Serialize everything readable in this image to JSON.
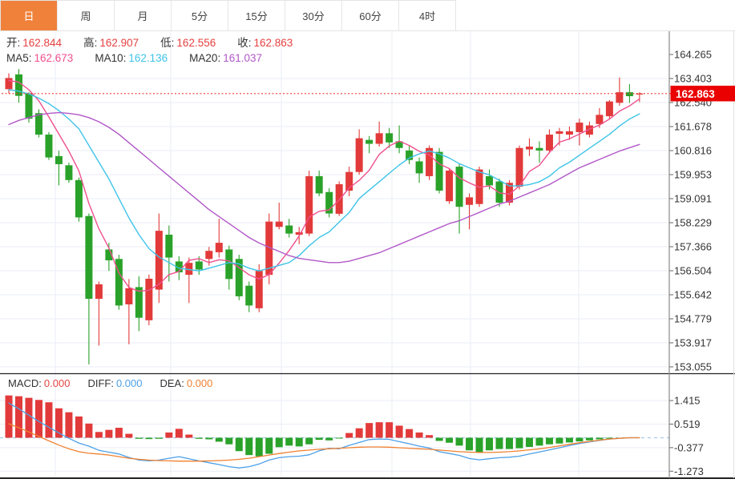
{
  "tabbar": {
    "tabs": [
      {
        "label": "日",
        "active": true
      },
      {
        "label": "周",
        "active": false
      },
      {
        "label": "月",
        "active": false
      },
      {
        "label": "5分",
        "active": false
      },
      {
        "label": "15分",
        "active": false
      },
      {
        "label": "30分",
        "active": false
      },
      {
        "label": "60分",
        "active": false
      },
      {
        "label": "4时",
        "active": false
      }
    ]
  },
  "info": {
    "ohlc": [
      {
        "label": "开:",
        "value": "162.844"
      },
      {
        "label": "高:",
        "value": "162.907"
      },
      {
        "label": "低:",
        "value": "162.556"
      },
      {
        "label": "收:",
        "value": "162.863"
      }
    ],
    "ma": [
      {
        "label": "MA5:",
        "value": "162.673"
      },
      {
        "label": "MA10:",
        "value": "162.136"
      },
      {
        "label": "MA20:",
        "value": "161.037"
      }
    ]
  },
  "macd_header": {
    "items": [
      {
        "label": "MACD:",
        "value": "0.000"
      },
      {
        "label": "DIFF:",
        "value": "0.000"
      },
      {
        "label": "DEA:",
        "value": "0.000"
      }
    ]
  },
  "colors": {
    "up": "#e23a3a",
    "down": "#2aa22a",
    "ma5": "#f0508e",
    "ma10": "#3fc3e8",
    "ma20": "#b158c8",
    "diff": "#4da0e8",
    "dea": "#f08030",
    "grid": "#e9eef6",
    "zero_dash": "#a9cbe8",
    "price_line": "#f03838",
    "price_label_bg": "#ea0000",
    "axis_line": "#888888",
    "dark_border": "#222222",
    "tab_active_bg": "#f0813a"
  },
  "chart_data": {
    "type": "candlestick+macd",
    "format": "candles are [open, high, low, close]",
    "main": {
      "y_tick_labels": [
        "164.265",
        "163.403",
        "162.540",
        "161.678",
        "160.816",
        "159.953",
        "159.091",
        "158.229",
        "157.366",
        "156.504",
        "155.642",
        "154.779",
        "153.917",
        "153.055"
      ],
      "current_price": 162.863,
      "current_price_label": "162.863",
      "candles": [
        [
          163.02,
          163.59,
          162.87,
          163.42
        ],
        [
          163.55,
          163.74,
          162.54,
          162.78
        ],
        [
          162.87,
          162.91,
          161.82,
          161.96
        ],
        [
          162.16,
          162.3,
          161.29,
          161.39
        ],
        [
          161.39,
          161.48,
          160.48,
          160.57
        ],
        [
          160.62,
          160.81,
          159.57,
          160.33
        ],
        [
          160.29,
          160.38,
          159.66,
          159.76
        ],
        [
          159.76,
          159.85,
          158.27,
          158.42
        ],
        [
          158.47,
          158.56,
          153.15,
          155.5
        ],
        [
          155.5,
          156.12,
          153.82,
          156.02
        ],
        [
          157.27,
          157.51,
          156.5,
          156.88
        ],
        [
          156.93,
          157.08,
          155.11,
          155.26
        ],
        [
          155.3,
          156.21,
          153.87,
          155.88
        ],
        [
          155.92,
          156.31,
          154.34,
          154.82
        ],
        [
          154.73,
          156.37,
          154.55,
          156.22
        ],
        [
          155.83,
          158.56,
          155.35,
          157.94
        ],
        [
          157.8,
          158.13,
          156.12,
          156.98
        ],
        [
          156.84,
          157.03,
          156.17,
          156.45
        ],
        [
          156.36,
          156.98,
          155.35,
          156.79
        ],
        [
          156.84,
          157.03,
          156.36,
          156.55
        ],
        [
          156.93,
          157.36,
          156.69,
          157.22
        ],
        [
          157.17,
          158.37,
          156.98,
          157.51
        ],
        [
          157.27,
          157.41,
          155.83,
          156.21
        ],
        [
          156.93,
          157.08,
          155.45,
          155.59
        ],
        [
          155.97,
          156.12,
          155.02,
          155.26
        ],
        [
          155.16,
          156.74,
          155.02,
          156.5
        ],
        [
          156.36,
          158.56,
          156.02,
          158.27
        ],
        [
          158.08,
          158.95,
          157.99,
          158.27
        ],
        [
          158.13,
          158.37,
          157.7,
          157.84
        ],
        [
          157.8,
          158.08,
          157.46,
          157.89
        ],
        [
          157.84,
          160.1,
          157.75,
          159.9
        ],
        [
          159.9,
          160.1,
          159.18,
          159.28
        ],
        [
          159.33,
          159.47,
          158.42,
          158.56
        ],
        [
          158.55,
          159.71,
          158.47,
          159.61
        ],
        [
          159.38,
          160.24,
          159.18,
          160.05
        ],
        [
          160.05,
          161.58,
          159.95,
          161.26
        ],
        [
          161.2,
          161.34,
          160.72,
          161.06
        ],
        [
          161.06,
          161.86,
          160.96,
          161.44
        ],
        [
          161.44,
          161.63,
          160.91,
          161.11
        ],
        [
          161.15,
          161.72,
          160.72,
          160.91
        ],
        [
          160.82,
          161.0,
          160.33,
          160.48
        ],
        [
          160.43,
          160.57,
          159.66,
          160.0
        ],
        [
          159.9,
          161.0,
          159.76,
          160.91
        ],
        [
          160.77,
          160.91,
          159.28,
          159.38
        ],
        [
          159.0,
          160.19,
          158.9,
          160.1
        ],
        [
          160.24,
          160.33,
          157.84,
          158.8
        ],
        [
          158.87,
          159.28,
          157.99,
          159.14
        ],
        [
          158.9,
          160.24,
          158.8,
          160.14
        ],
        [
          159.9,
          160.14,
          159.42,
          159.57
        ],
        [
          159.71,
          159.81,
          158.8,
          158.95
        ],
        [
          158.95,
          159.76,
          158.85,
          159.66
        ],
        [
          159.52,
          161.0,
          159.42,
          160.91
        ],
        [
          160.86,
          161.26,
          160.62,
          160.96
        ],
        [
          160.91,
          161.15,
          160.38,
          160.82
        ],
        [
          160.82,
          161.58,
          160.72,
          161.39
        ],
        [
          161.42,
          161.63,
          161.0,
          161.51
        ],
        [
          161.39,
          161.68,
          161.2,
          161.51
        ],
        [
          161.48,
          161.96,
          161.0,
          161.82
        ],
        [
          161.39,
          161.86,
          161.29,
          161.72
        ],
        [
          161.77,
          162.34,
          161.63,
          162.1
        ],
        [
          162.05,
          162.63,
          161.96,
          162.58
        ],
        [
          162.53,
          163.44,
          162.43,
          162.91
        ],
        [
          162.91,
          163.2,
          162.53,
          162.77
        ],
        [
          162.844,
          162.907,
          162.556,
          162.863
        ]
      ],
      "overlays": [
        {
          "name": "MA5",
          "color": "#f0508e",
          "values": [
            163.33,
            163.27,
            163.0,
            162.6,
            162.02,
            161.41,
            160.8,
            160.09,
            158.92,
            158.01,
            157.32,
            156.42,
            155.91,
            155.77,
            155.81,
            156.02,
            156.37,
            156.48,
            156.88,
            156.94,
            156.8,
            156.9,
            156.86,
            156.62,
            156.36,
            156.21,
            156.37,
            156.78,
            157.23,
            157.75,
            158.43,
            158.64,
            158.69,
            159.05,
            159.48,
            159.75,
            160.11,
            160.68,
            160.98,
            161.16,
            161.0,
            160.79,
            160.66,
            160.34,
            160.17,
            159.84,
            159.66,
            159.5,
            159.55,
            159.3,
            159.25,
            159.55,
            160.07,
            160.29,
            160.75,
            161.12,
            161.24,
            161.41,
            161.59,
            161.73,
            161.95,
            162.23,
            162.42,
            162.673
          ]
        },
        {
          "name": "MA10",
          "color": "#3fc3e8",
          "values": [
            163.0,
            162.95,
            162.85,
            162.7,
            162.5,
            162.25,
            161.95,
            161.6,
            161.0,
            160.4,
            159.8,
            159.1,
            158.4,
            157.8,
            157.3,
            157.0,
            156.8,
            156.6,
            156.55,
            156.5,
            156.6,
            156.7,
            156.8,
            156.75,
            156.6,
            156.5,
            156.6,
            156.7,
            156.8,
            157.05,
            157.4,
            157.7,
            157.9,
            158.25,
            158.6,
            159.1,
            159.4,
            159.7,
            160.0,
            160.3,
            160.55,
            160.7,
            160.8,
            160.7,
            160.55,
            160.35,
            160.2,
            160.05,
            159.95,
            159.75,
            159.55,
            159.55,
            159.6,
            159.7,
            159.9,
            160.2,
            160.4,
            160.65,
            160.9,
            161.15,
            161.4,
            161.7,
            161.95,
            162.136
          ]
        },
        {
          "name": "MA20",
          "color": "#b158c8",
          "values": [
            161.75,
            161.9,
            162.0,
            162.1,
            162.15,
            162.18,
            162.15,
            162.1,
            162.0,
            161.85,
            161.65,
            161.4,
            161.1,
            160.8,
            160.5,
            160.2,
            159.9,
            159.6,
            159.3,
            159.0,
            158.7,
            158.45,
            158.2,
            157.95,
            157.7,
            157.5,
            157.35,
            157.2,
            157.05,
            156.95,
            156.9,
            156.85,
            156.8,
            156.8,
            156.85,
            156.95,
            157.05,
            157.15,
            157.3,
            157.45,
            157.6,
            157.75,
            157.9,
            158.05,
            158.2,
            158.3,
            158.45,
            158.6,
            158.75,
            158.9,
            159.0,
            159.15,
            159.3,
            159.45,
            159.6,
            159.8,
            160.0,
            160.2,
            160.35,
            160.5,
            160.65,
            160.8,
            160.92,
            161.037
          ]
        }
      ]
    },
    "macd": {
      "y_tick_labels": [
        "1.415",
        "0.519",
        "-0.377",
        "-1.273"
      ],
      "histogram": [
        1.61,
        1.58,
        1.52,
        1.44,
        1.35,
        1.12,
        0.97,
        0.81,
        0.54,
        0.22,
        0.3,
        0.38,
        0.15,
        -0.04,
        -0.05,
        -0.04,
        0.2,
        0.34,
        0.12,
        -0.04,
        -0.06,
        -0.15,
        -0.25,
        -0.51,
        -0.66,
        -0.71,
        -0.61,
        -0.36,
        -0.3,
        -0.33,
        -0.25,
        -0.08,
        -0.1,
        -0.03,
        0.18,
        0.36,
        0.56,
        0.59,
        0.59,
        0.46,
        0.33,
        0.2,
        0.1,
        -0.12,
        -0.19,
        -0.3,
        -0.48,
        -0.56,
        -0.48,
        -0.43,
        -0.43,
        -0.4,
        -0.35,
        -0.3,
        -0.25,
        -0.22,
        -0.18,
        -0.14,
        -0.1,
        -0.06,
        -0.03,
        -0.01,
        0.0,
        0.0
      ],
      "lines": [
        {
          "name": "DIFF",
          "color": "#4da0e8",
          "values": [
            1.32,
            1.1,
            0.86,
            0.62,
            0.4,
            0.18,
            -0.02,
            -0.2,
            -0.32,
            -0.48,
            -0.55,
            -0.62,
            -0.75,
            -0.85,
            -0.88,
            -0.85,
            -0.78,
            -0.72,
            -0.8,
            -0.88,
            -0.95,
            -1.02,
            -1.1,
            -1.15,
            -1.1,
            -1.0,
            -0.85,
            -0.76,
            -0.72,
            -0.7,
            -0.65,
            -0.5,
            -0.4,
            -0.42,
            -0.29,
            -0.18,
            -0.07,
            -0.05,
            -0.06,
            -0.15,
            -0.23,
            -0.32,
            -0.39,
            -0.53,
            -0.6,
            -0.67,
            -0.79,
            -0.84,
            -0.8,
            -0.76,
            -0.74,
            -0.7,
            -0.62,
            -0.54,
            -0.46,
            -0.38,
            -0.3,
            -0.22,
            -0.16,
            -0.1,
            -0.05,
            -0.02,
            0.0,
            0.0
          ]
        },
        {
          "name": "DEA",
          "color": "#f08030",
          "values": [
            0.53,
            0.38,
            0.22,
            0.05,
            -0.12,
            -0.28,
            -0.42,
            -0.53,
            -0.59,
            -0.62,
            -0.66,
            -0.72,
            -0.78,
            -0.82,
            -0.85,
            -0.87,
            -0.88,
            -0.89,
            -0.89,
            -0.89,
            -0.88,
            -0.87,
            -0.85,
            -0.82,
            -0.78,
            -0.72,
            -0.66,
            -0.6,
            -0.55,
            -0.5,
            -0.47,
            -0.44,
            -0.42,
            -0.4,
            -0.38,
            -0.36,
            -0.35,
            -0.35,
            -0.36,
            -0.38,
            -0.4,
            -0.42,
            -0.44,
            -0.47,
            -0.5,
            -0.53,
            -0.55,
            -0.56,
            -0.56,
            -0.55,
            -0.53,
            -0.5,
            -0.46,
            -0.42,
            -0.37,
            -0.31,
            -0.25,
            -0.19,
            -0.14,
            -0.09,
            -0.05,
            -0.02,
            0.0,
            0.0
          ]
        }
      ]
    }
  }
}
